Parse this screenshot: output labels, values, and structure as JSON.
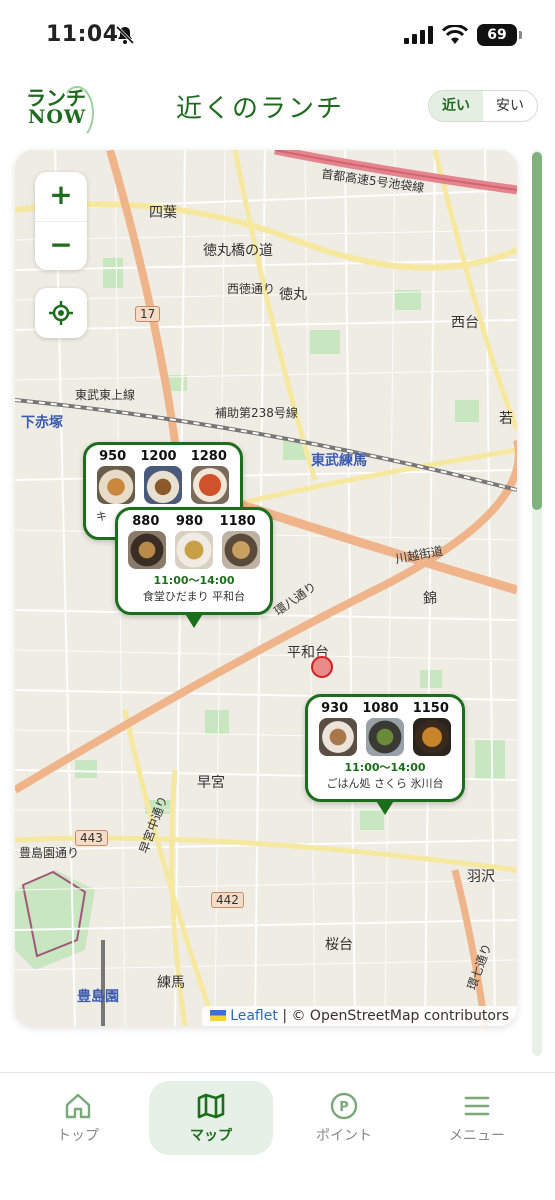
{
  "status_bar": {
    "time": "11:04",
    "battery": "69"
  },
  "header": {
    "logo_line1": "ランチ",
    "logo_line2": "NOW",
    "title": "近くのランチ",
    "toggle": {
      "near": "近い",
      "cheap": "安い",
      "selected": "近い"
    }
  },
  "map": {
    "zoom_in": "+",
    "zoom_out": "−",
    "labels": {
      "shiba": "四葉",
      "tokumarubashi": "徳丸橋の道",
      "nishitoku": "西徳通り",
      "tokumaru": "徳丸",
      "nishidai": "西台",
      "hojo": "補助第238号線",
      "tobu": "東武東上線",
      "shimoakatsuka": "下赤塚",
      "tobunerima": "東武練馬",
      "heiwadai": "平和台",
      "nishiki": "錦",
      "hayamiya": "早宮",
      "hanezawa": "羽沢",
      "sakuradai": "桜台",
      "nerima": "練馬",
      "toshimaen": "豊島園",
      "shuto": "首都高速5号池袋線",
      "kawagoe": "川越街道",
      "kannana": "環七通り",
      "kanpachi": "環八通り",
      "toshima_road": "豊島園通り",
      "hayamiya_naka": "早宮中通り",
      "wakaba": "若"
    },
    "road_tags": [
      "17",
      "443",
      "442"
    ],
    "attribution": {
      "leaflet": "Leaflet",
      "rest": "| © OpenStreetMap contributors"
    }
  },
  "markers": [
    {
      "prices": [
        "950",
        "1200",
        "1280"
      ],
      "name": "キ"
    },
    {
      "prices": [
        "880",
        "980",
        "1180"
      ],
      "hours": "11:00〜14:00",
      "name": "食堂ひだまり 平和台"
    },
    {
      "prices": [
        "930",
        "1080",
        "1150"
      ],
      "hours": "11:00〜14:00",
      "name": "ごはん処 さくら 氷川台"
    }
  ],
  "nav": {
    "top": "トップ",
    "map": "マップ",
    "point": "ポイント",
    "menu": "メニュー",
    "active": "マップ"
  },
  "colors": {
    "brand": "#1b6e1b",
    "active_bg": "#e6f0e6"
  }
}
